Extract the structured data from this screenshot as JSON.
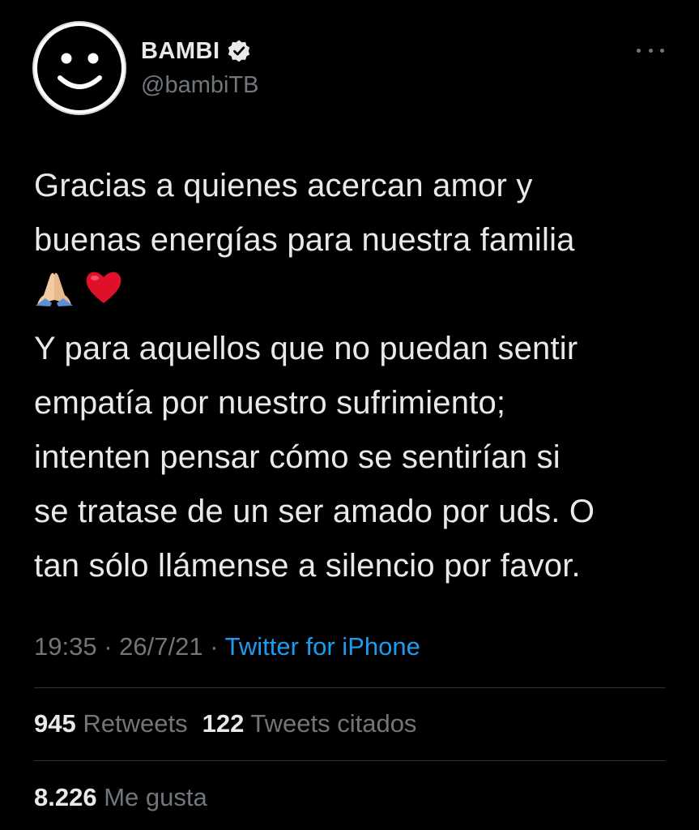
{
  "user": {
    "display_name": "BAMBI",
    "handle": "@bambiTB",
    "verified": true
  },
  "tweet": {
    "lines_part1": [
      "Gracias a quienes acercan amor y",
      "buenas energías para nuestra familia"
    ],
    "emojis": [
      "folded-hands-icon",
      "red-heart-icon"
    ],
    "lines_part2": [
      "Y para aquellos que no puedan sentir",
      "empatía por nuestro sufrimiento;",
      "intenten pensar cómo se sentirían si",
      "se tratase de un ser amado por uds. O",
      "tan sólo llámense a silencio por favor."
    ],
    "time": "19:35",
    "date": "26/7/21",
    "separator": "·",
    "source": "Twitter for iPhone"
  },
  "stats": {
    "retweets_count": "945",
    "retweets_label": "Retweets",
    "quotes_count": "122",
    "quotes_label": "Tweets citados",
    "likes_count": "8.226",
    "likes_label": "Me gusta"
  },
  "colors": {
    "background": "#000000",
    "text": "#e7e9ea",
    "secondary": "#71767b",
    "link": "#1d9bf0",
    "divider": "#2f3336"
  }
}
